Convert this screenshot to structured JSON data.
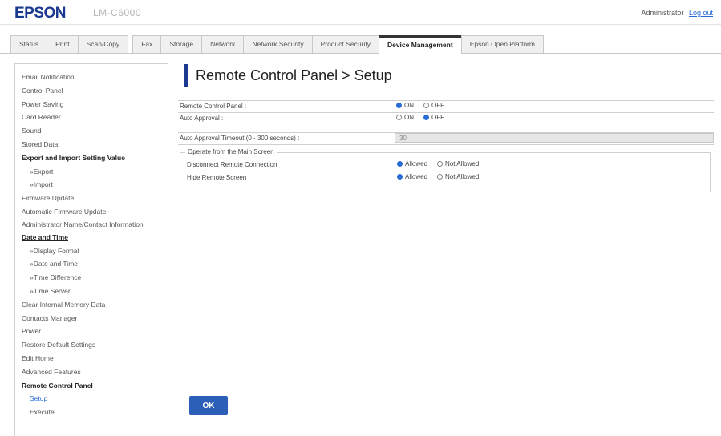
{
  "header": {
    "brand": "EPSON",
    "model": "LM-C6000",
    "admin_label": "Administrator",
    "logout_label": "Log out"
  },
  "tabs": [
    {
      "label": "Status"
    },
    {
      "label": "Print"
    },
    {
      "label": "Scan/Copy"
    },
    {
      "label": "Fax"
    },
    {
      "label": "Storage"
    },
    {
      "label": "Network"
    },
    {
      "label": "Network Security"
    },
    {
      "label": "Product Security"
    },
    {
      "label": "Device Management"
    },
    {
      "label": "Epson Open Platform"
    }
  ],
  "active_tab": "Device Management",
  "sidebar": {
    "items": [
      {
        "label": "Email Notification"
      },
      {
        "label": "Control Panel"
      },
      {
        "label": "Power Saving"
      },
      {
        "label": "Card Reader"
      },
      {
        "label": "Sound"
      },
      {
        "label": "Stored Data"
      },
      {
        "label": "Export and Import Setting Value"
      },
      {
        "label": "»Export"
      },
      {
        "label": "»Import"
      },
      {
        "label": "Firmware Update"
      },
      {
        "label": "Automatic Firmware Update"
      },
      {
        "label": "Administrator Name/Contact Information"
      },
      {
        "label": "Date and Time"
      },
      {
        "label": "»Display Format"
      },
      {
        "label": "»Date and Time"
      },
      {
        "label": "»Time Difference"
      },
      {
        "label": "»Time Server"
      },
      {
        "label": "Clear Internal Memory Data"
      },
      {
        "label": "Contacts Manager"
      },
      {
        "label": "Power"
      },
      {
        "label": "Restore Default Settings"
      },
      {
        "label": "Edit Home"
      },
      {
        "label": "Advanced Features"
      },
      {
        "label": "Remote Control Panel"
      },
      {
        "label": "Setup"
      },
      {
        "label": "Execute"
      }
    ]
  },
  "main": {
    "title": "Remote Control Panel > Setup",
    "remote_control_panel": {
      "label": "Remote Control Panel :",
      "on": "ON",
      "off": "OFF",
      "selected": "ON"
    },
    "auto_approval": {
      "label": "Auto Approval :",
      "on": "ON",
      "off": "OFF",
      "selected": "OFF"
    },
    "auto_approval_timeout": {
      "label": "Auto Approval Timeout (0 - 300 seconds) :",
      "value": "30"
    },
    "operate_group": {
      "legend": "Operate from the Main Screen",
      "disconnect": {
        "label": "Disconnect Remote Connection",
        "allowed": "Allowed",
        "not_allowed": "Not Allowed",
        "selected": "Allowed"
      },
      "hide_screen": {
        "label": "Hide Remote Screen",
        "allowed": "Allowed",
        "not_allowed": "Not Allowed",
        "selected": "Allowed"
      }
    },
    "ok_label": "OK"
  },
  "colors": {
    "brand": "#1b3a8f",
    "accent": "#2b6bd6",
    "button": "#2b5fb8"
  }
}
